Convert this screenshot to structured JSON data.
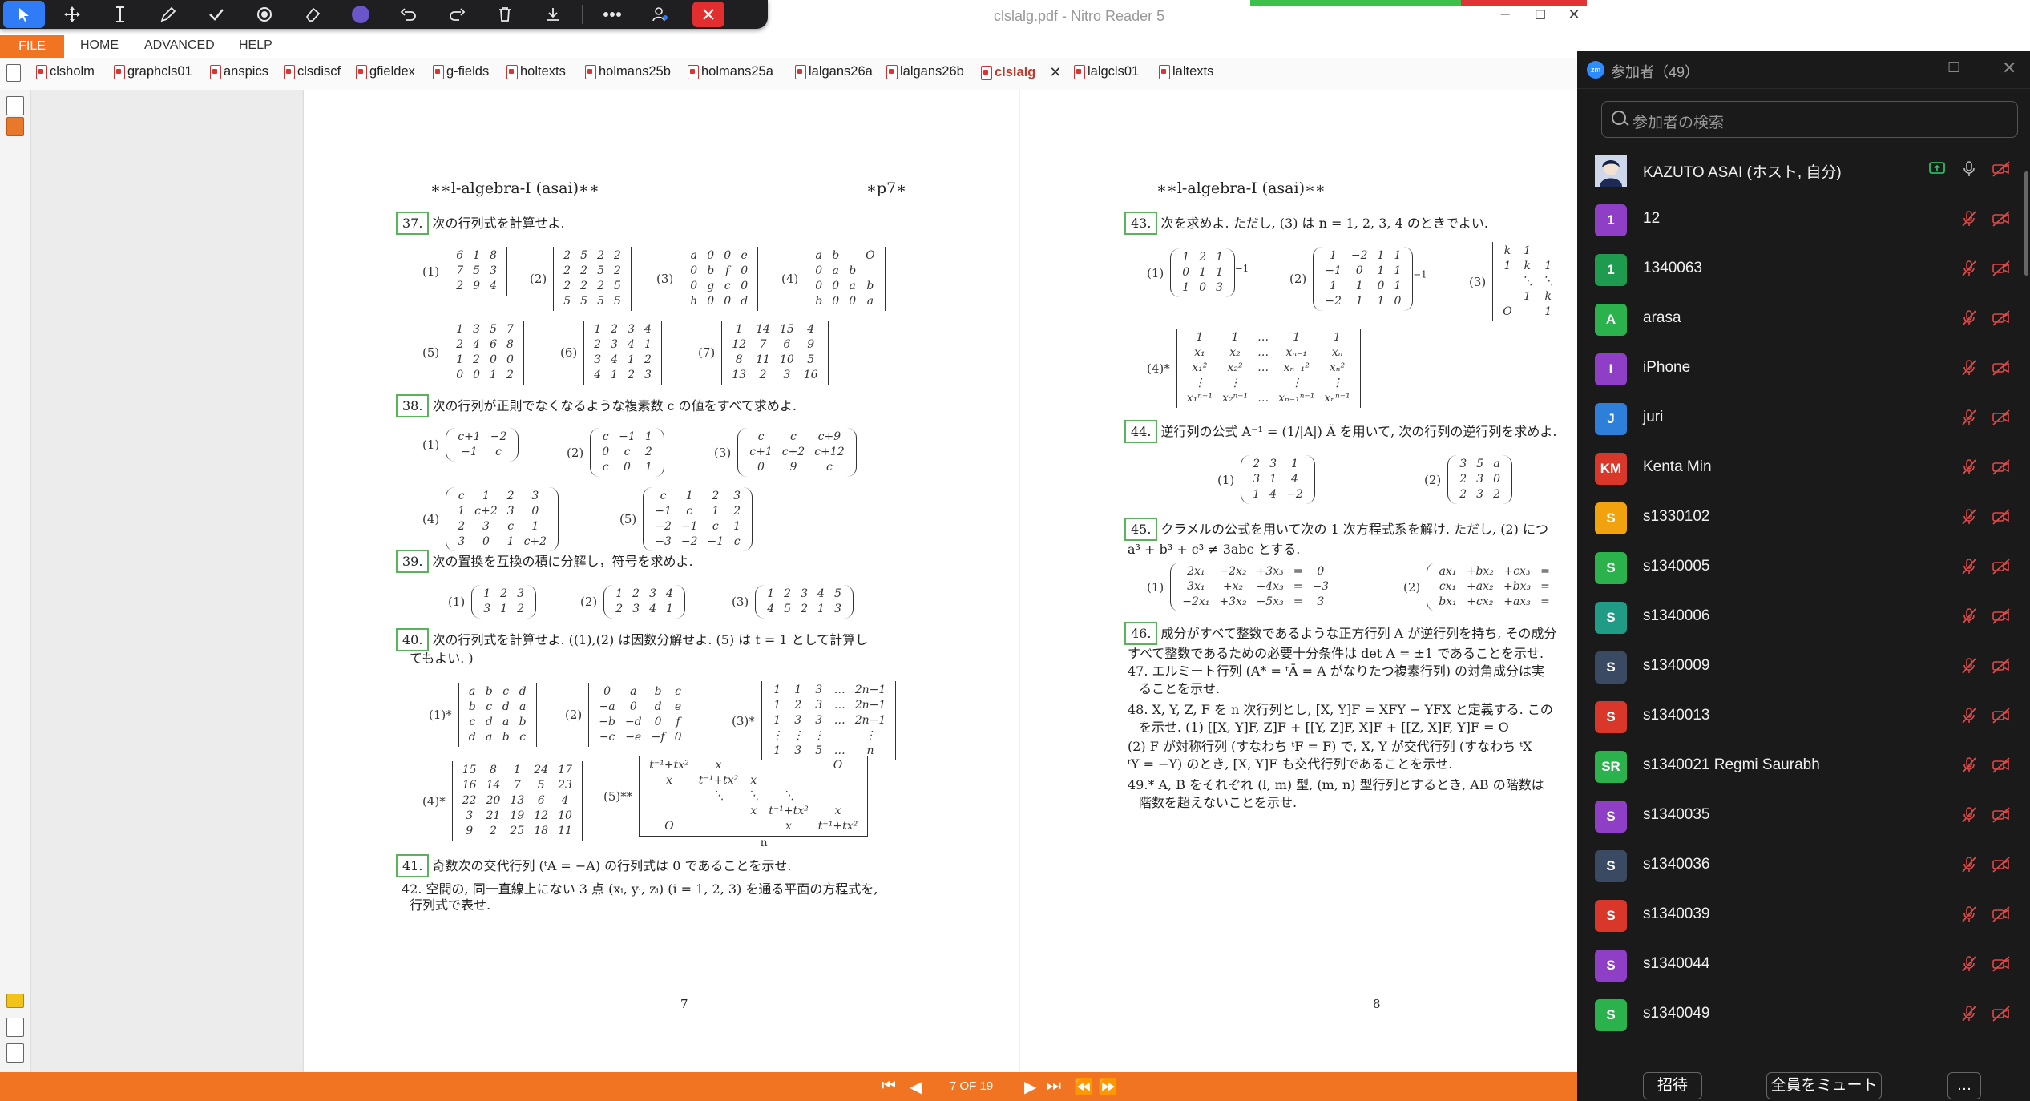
{
  "window": {
    "title": "clslalg.pdf - Nitro Reader 5",
    "controls": [
      "–",
      "☐",
      "✕"
    ]
  },
  "floating_toolbar": {
    "tools": [
      "select-tool",
      "move-tool",
      "text-tool",
      "pen-tool",
      "check-tool",
      "highlighter-tool",
      "eraser-tool",
      "color-picker",
      "undo",
      "redo",
      "delete",
      "download",
      "more",
      "participants",
      "close"
    ]
  },
  "menu": {
    "file": "FILE",
    "items": [
      "HOME",
      "ADVANCED",
      "HELP"
    ]
  },
  "tabs": [
    {
      "label": "clsholm"
    },
    {
      "label": "graphcls01"
    },
    {
      "label": "anspics"
    },
    {
      "label": "clsdiscf"
    },
    {
      "label": "gfieldex"
    },
    {
      "label": "g-fields"
    },
    {
      "label": "holtexts"
    },
    {
      "label": "holmans25b"
    },
    {
      "label": "holmans25a"
    },
    {
      "label": "lalgans26a"
    },
    {
      "label": "lalgans26b"
    },
    {
      "label": "clslalg",
      "active": true
    },
    {
      "label": "lalgcls01"
    },
    {
      "label": "laltexts"
    }
  ],
  "page_left": {
    "header_left": "∗∗l-algebra-I (asai)∗∗",
    "header_right": "∗p7∗",
    "page_number": "7",
    "problems": {
      "p37": {
        "num": "37.",
        "text": "次の行列式を計算せよ."
      },
      "p38": {
        "num": "38.",
        "text": "次の行列が正則でなくなるような複素数 c の値をすべて求めよ."
      },
      "p39": {
        "num": "39.",
        "text": "次の置換を互換の積に分解し，符号を求めよ."
      },
      "p40": {
        "num": "40.",
        "text": "次の行列式を計算せよ. ((1),(2) は因数分解せよ. (5) は t = 1 として計算し",
        "text2": "てもよい. )"
      },
      "p41": {
        "num": "41.",
        "text": "奇数次の交代行列 (ᵗA = −A) の行列式は 0 であることを示せ."
      },
      "p42": {
        "text": "42. 空間の, 同一直線上にない 3 点 (xᵢ, yᵢ, zᵢ) (i = 1, 2, 3) を通る平面の方程式を,",
        "text2": "行列式で表せ."
      }
    },
    "m37": [
      {
        "label": "(1)",
        "rows": [
          [
            "6",
            "1",
            "8"
          ],
          [
            "7",
            "5",
            "3"
          ],
          [
            "2",
            "9",
            "4"
          ]
        ]
      },
      {
        "label": "(2)",
        "rows": [
          [
            "2",
            "5",
            "2",
            "2"
          ],
          [
            "2",
            "2",
            "5",
            "2"
          ],
          [
            "2",
            "2",
            "2",
            "5"
          ],
          [
            "5",
            "5",
            "5",
            "5"
          ]
        ]
      },
      {
        "label": "(3)",
        "rows": [
          [
            "a",
            "0",
            "0",
            "e"
          ],
          [
            "0",
            "b",
            "f",
            "0"
          ],
          [
            "0",
            "g",
            "c",
            "0"
          ],
          [
            "h",
            "0",
            "0",
            "d"
          ]
        ]
      },
      {
        "label": "(4)",
        "rows": [
          [
            "a",
            "b",
            "",
            "O"
          ],
          [
            "0",
            "a",
            "b",
            ""
          ],
          [
            "0",
            "0",
            "a",
            "b"
          ],
          [
            "b",
            "0",
            "0",
            "a"
          ]
        ]
      },
      {
        "label": "(5)",
        "rows": [
          [
            "1",
            "3",
            "5",
            "7"
          ],
          [
            "2",
            "4",
            "6",
            "8"
          ],
          [
            "1",
            "2",
            "0",
            "0"
          ],
          [
            "0",
            "0",
            "1",
            "2"
          ]
        ]
      },
      {
        "label": "(6)",
        "rows": [
          [
            "1",
            "2",
            "3",
            "4"
          ],
          [
            "2",
            "3",
            "4",
            "1"
          ],
          [
            "3",
            "4",
            "1",
            "2"
          ],
          [
            "4",
            "1",
            "2",
            "3"
          ]
        ]
      },
      {
        "label": "(7)",
        "rows": [
          [
            "1",
            "14",
            "15",
            "4"
          ],
          [
            "12",
            "7",
            "6",
            "9"
          ],
          [
            "8",
            "11",
            "10",
            "5"
          ],
          [
            "13",
            "2",
            "3",
            "16"
          ]
        ]
      }
    ],
    "m38": [
      {
        "label": "(1)",
        "rows": [
          [
            "c+1",
            "−2"
          ],
          [
            "−1",
            "c"
          ]
        ]
      },
      {
        "label": "(2)",
        "rows": [
          [
            "c",
            "−1",
            "1"
          ],
          [
            "0",
            "c",
            "2"
          ],
          [
            "c",
            "0",
            "1"
          ]
        ]
      },
      {
        "label": "(3)",
        "rows": [
          [
            "c",
            "c",
            "c+9"
          ],
          [
            "c+1",
            "c+2",
            "c+12"
          ],
          [
            "0",
            "9",
            "c"
          ]
        ]
      },
      {
        "label": "(4)",
        "rows": [
          [
            "c",
            "1",
            "2",
            "3"
          ],
          [
            "1",
            "c+2",
            "3",
            "0"
          ],
          [
            "2",
            "3",
            "c",
            "1"
          ],
          [
            "3",
            "0",
            "1",
            "c+2"
          ]
        ]
      },
      {
        "label": "(5)",
        "rows": [
          [
            "c",
            "1",
            "2",
            "3"
          ],
          [
            "−1",
            "c",
            "1",
            "2"
          ],
          [
            "−2",
            "−1",
            "c",
            "1"
          ],
          [
            "−3",
            "−2",
            "−1",
            "c"
          ]
        ]
      }
    ],
    "m39": [
      {
        "label": "(1)",
        "rows": [
          [
            "1",
            "2",
            "3"
          ],
          [
            "3",
            "1",
            "2"
          ]
        ]
      },
      {
        "label": "(2)",
        "rows": [
          [
            "1",
            "2",
            "3",
            "4"
          ],
          [
            "2",
            "3",
            "4",
            "1"
          ]
        ]
      },
      {
        "label": "(3)",
        "rows": [
          [
            "1",
            "2",
            "3",
            "4",
            "5"
          ],
          [
            "4",
            "5",
            "2",
            "1",
            "3"
          ]
        ]
      }
    ],
    "m40": [
      {
        "label": "(1)*",
        "rows": [
          [
            "a",
            "b",
            "c",
            "d"
          ],
          [
            "b",
            "c",
            "d",
            "a"
          ],
          [
            "c",
            "d",
            "a",
            "b"
          ],
          [
            "d",
            "a",
            "b",
            "c"
          ]
        ]
      },
      {
        "label": "(2)",
        "rows": [
          [
            "0",
            "a",
            "b",
            "c"
          ],
          [
            "−a",
            "0",
            "d",
            "e"
          ],
          [
            "−b",
            "−d",
            "0",
            "f"
          ],
          [
            "−c",
            "−e",
            "−f",
            "0"
          ]
        ]
      },
      {
        "label": "(3)*",
        "rows": [
          [
            "1",
            "1",
            "3",
            "…",
            "2n−1"
          ],
          [
            "1",
            "2",
            "3",
            "…",
            "2n−1"
          ],
          [
            "1",
            "3",
            "3",
            "…",
            "2n−1"
          ],
          [
            "⋮",
            "⋮",
            "⋮",
            "",
            "⋮"
          ],
          [
            "1",
            "3",
            "5",
            "…",
            "n"
          ]
        ]
      },
      {
        "label": "(4)*",
        "rows": [
          [
            "15",
            "8",
            "1",
            "24",
            "17"
          ],
          [
            "16",
            "14",
            "7",
            "5",
            "23"
          ],
          [
            "22",
            "20",
            "13",
            "6",
            "4"
          ],
          [
            "3",
            "21",
            "19",
            "12",
            "10"
          ],
          [
            "9",
            "2",
            "25",
            "18",
            "11"
          ]
        ]
      },
      {
        "label": "(5)**",
        "rows": [
          [
            "t⁻¹+tx²",
            "x",
            "",
            "",
            "O"
          ],
          [
            "x",
            "t⁻¹+tx²",
            "x",
            "",
            ""
          ],
          [
            "",
            "⋱",
            "⋱",
            "⋱",
            ""
          ],
          [
            "",
            "",
            "x",
            "t⁻¹+tx²",
            "x"
          ],
          [
            "O",
            "",
            "",
            "x",
            "t⁻¹+tx²"
          ]
        ],
        "under": "n"
      }
    ]
  },
  "page_right": {
    "header_left": "∗∗l-algebra-I (asai)∗∗",
    "page_number": "8",
    "p43": {
      "num": "43.",
      "text": "次を求めよ. ただし, (3) は n = 1, 2, 3, 4 のときでよい."
    },
    "m43": [
      {
        "label": "(1)",
        "rows": [
          [
            "1",
            "2",
            "1"
          ],
          [
            "0",
            "1",
            "1"
          ],
          [
            "1",
            "0",
            "3"
          ]
        ],
        "sup": "−1"
      },
      {
        "label": "(2)",
        "rows": [
          [
            "1",
            "−2",
            "1",
            "1"
          ],
          [
            "−1",
            "0",
            "1",
            "1"
          ],
          [
            "1",
            "1",
            "0",
            "1"
          ],
          [
            "−2",
            "1",
            "1",
            "0"
          ]
        ],
        "sup": "−1"
      },
      {
        "label": "(3)",
        "rows": [
          [
            "k",
            "1",
            ""
          ],
          [
            "1",
            "k",
            "1"
          ],
          [
            "",
            "⋱",
            "⋱"
          ],
          [
            "",
            "1",
            "k"
          ],
          [
            "O",
            "",
            "1"
          ]
        ]
      },
      {
        "label": "(4)*",
        "rows": [
          [
            "1",
            "1",
            "…",
            "1",
            "1"
          ],
          [
            "x₁",
            "x₂",
            "…",
            "xₙ₋₁",
            "xₙ"
          ],
          [
            "x₁²",
            "x₂²",
            "…",
            "xₙ₋₁²",
            "xₙ²"
          ],
          [
            "⋮",
            "⋮",
            "",
            "⋮",
            "⋮"
          ],
          [
            "x₁ⁿ⁻¹",
            "x₂ⁿ⁻¹",
            "…",
            "xₙ₋₁ⁿ⁻¹",
            "xₙⁿ⁻¹"
          ]
        ]
      }
    ],
    "p44": {
      "num": "44.",
      "text": "逆行列の公式 A⁻¹ = (1/|A|) Ã を用いて, 次の行列の逆行列を求めよ."
    },
    "m44": [
      {
        "label": "(1)",
        "rows": [
          [
            "2",
            "3",
            "1"
          ],
          [
            "3",
            "1",
            "4"
          ],
          [
            "1",
            "4",
            "−2"
          ]
        ]
      },
      {
        "label": "(2)",
        "rows": [
          [
            "3",
            "5",
            "a"
          ],
          [
            "2",
            "3",
            "0"
          ],
          [
            "2",
            "3",
            "2"
          ]
        ]
      }
    ],
    "p45": {
      "num": "45.",
      "text": "クラメルの公式を用いて次の 1 次方程式系を解け. ただし, (2) につ",
      "text2": "a³ + b³ + c³ ≠ 3abc とする."
    },
    "m45": [
      {
        "label": "(1)",
        "rows": [
          [
            "2x₁",
            "−2x₂",
            "+3x₃",
            "=",
            "0"
          ],
          [
            "3x₁",
            "+x₂",
            "+4x₃",
            "=",
            "−3"
          ],
          [
            "−2x₁",
            "+3x₂",
            "−5x₃",
            "=",
            "3"
          ]
        ]
      },
      {
        "label": "(2)",
        "rows": [
          [
            "ax₁",
            "+bx₂",
            "+cx₃",
            "="
          ],
          [
            "cx₁",
            "+ax₂",
            "+bx₃",
            "="
          ],
          [
            "bx₁",
            "+cx₂",
            "+ax₃",
            "="
          ]
        ]
      }
    ],
    "p46": {
      "num": "46.",
      "text": "成分がすべて整数であるような正方行列 A が逆行列を持ち, その成分",
      "text2": "すべて整数であるための必要十分条件は det A = ±1 であることを示せ."
    },
    "p47": {
      "text": "47. エルミート行列 (A* = ᵗĀ = A がなりたつ複素行列) の対角成分は実",
      "text2": "ることを示せ."
    },
    "p48": {
      "text": "48. X, Y, Z, F を n 次行列とし, [X, Y]F = XFY − YFX と定義する. この",
      "text2": "を示せ. (1) [[X, Y]F, Z]F + [[Y, Z]F, X]F + [[Z, X]F, Y]F = O",
      "text3": "(2) F が対称行列 (すなわち ᵗF = F) で, X, Y が交代行列 (すなわち ᵗX",
      "text4": "ᵗY = −Y) のとき, [X, Y]F も交代行列であることを示せ."
    },
    "p49": {
      "text": "49.* A, B をそれぞれ (l, m) 型, (m, n) 型行列とするとき, AB の階数は",
      "text2": "階数を超えないことを示せ."
    }
  },
  "status": {
    "page_indicator": "7 OF 19"
  },
  "zoom": {
    "title": "参加者（49）",
    "logo": "zm",
    "search_placeholder": "参加者の検索",
    "participants": [
      {
        "name": "KAZUTO ASAI (ホスト, 自分)",
        "initials": "",
        "color": "#ffffff",
        "host": true
      },
      {
        "name": "12",
        "initials": "1",
        "color": "#8e3fc6"
      },
      {
        "name": "1340063",
        "initials": "1",
        "color": "#1f9b4f"
      },
      {
        "name": "arasa",
        "initials": "A",
        "color": "#2bb24c"
      },
      {
        "name": "iPhone",
        "initials": "I",
        "color": "#8e3fc6"
      },
      {
        "name": "juri",
        "initials": "J",
        "color": "#2d7fd9"
      },
      {
        "name": "Kenta Min",
        "initials": "KM",
        "color": "#d9372a"
      },
      {
        "name": "s1330102",
        "initials": "S",
        "color": "#f2a20d"
      },
      {
        "name": "s1340005",
        "initials": "S",
        "color": "#2bb24c"
      },
      {
        "name": "s1340006",
        "initials": "S",
        "color": "#1f9b86"
      },
      {
        "name": "s1340009",
        "initials": "S",
        "color": "#3a4a63"
      },
      {
        "name": "s1340013",
        "initials": "S",
        "color": "#d9372a"
      },
      {
        "name": "s1340021 Regmi Saurabh",
        "initials": "SR",
        "color": "#2bb24c"
      },
      {
        "name": "s1340035",
        "initials": "S",
        "color": "#8e3fc6"
      },
      {
        "name": "s1340036",
        "initials": "S",
        "color": "#3a4a63"
      },
      {
        "name": "s1340039",
        "initials": "S",
        "color": "#d9372a"
      },
      {
        "name": "s1340044",
        "initials": "S",
        "color": "#8e3fc6"
      },
      {
        "name": "s1340049",
        "initials": "S",
        "color": "#2bb24c"
      }
    ],
    "invite_label": "招待",
    "mute_all_label": "全員をミュート",
    "more_label": "…"
  }
}
